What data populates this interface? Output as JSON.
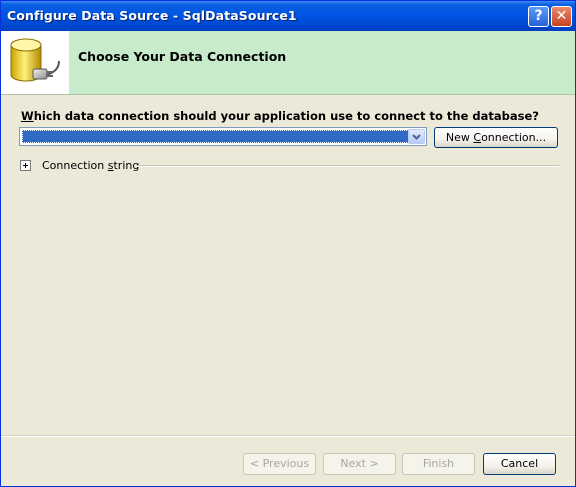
{
  "window": {
    "title": "Configure Data Source - SqlDataSource1",
    "help_glyph": "?",
    "close_glyph": "✕"
  },
  "header": {
    "title": "Choose Your Data Connection",
    "icon": "database-connection-icon"
  },
  "main": {
    "question_prefix": "W",
    "question_rest": "hich data connection should your application use to connect to the database?",
    "connection_select": {
      "selected_value": ""
    },
    "new_connection_prefix": "New ",
    "new_connection_underlined": "C",
    "new_connection_rest": "onnection...",
    "connection_string_prefix": "Connection ",
    "connection_string_underlined": "s",
    "connection_string_rest": "tring"
  },
  "footer": {
    "previous_label": "< Previous",
    "previous_underlined": "P",
    "next_label": "Next >",
    "finish_label": "Finish",
    "cancel_label": "Cancel"
  },
  "colors": {
    "titlebar": "#0055e5",
    "header_bg": "#c8ebcc",
    "dialog_bg": "#ece9d8",
    "selection": "#316ac5"
  }
}
